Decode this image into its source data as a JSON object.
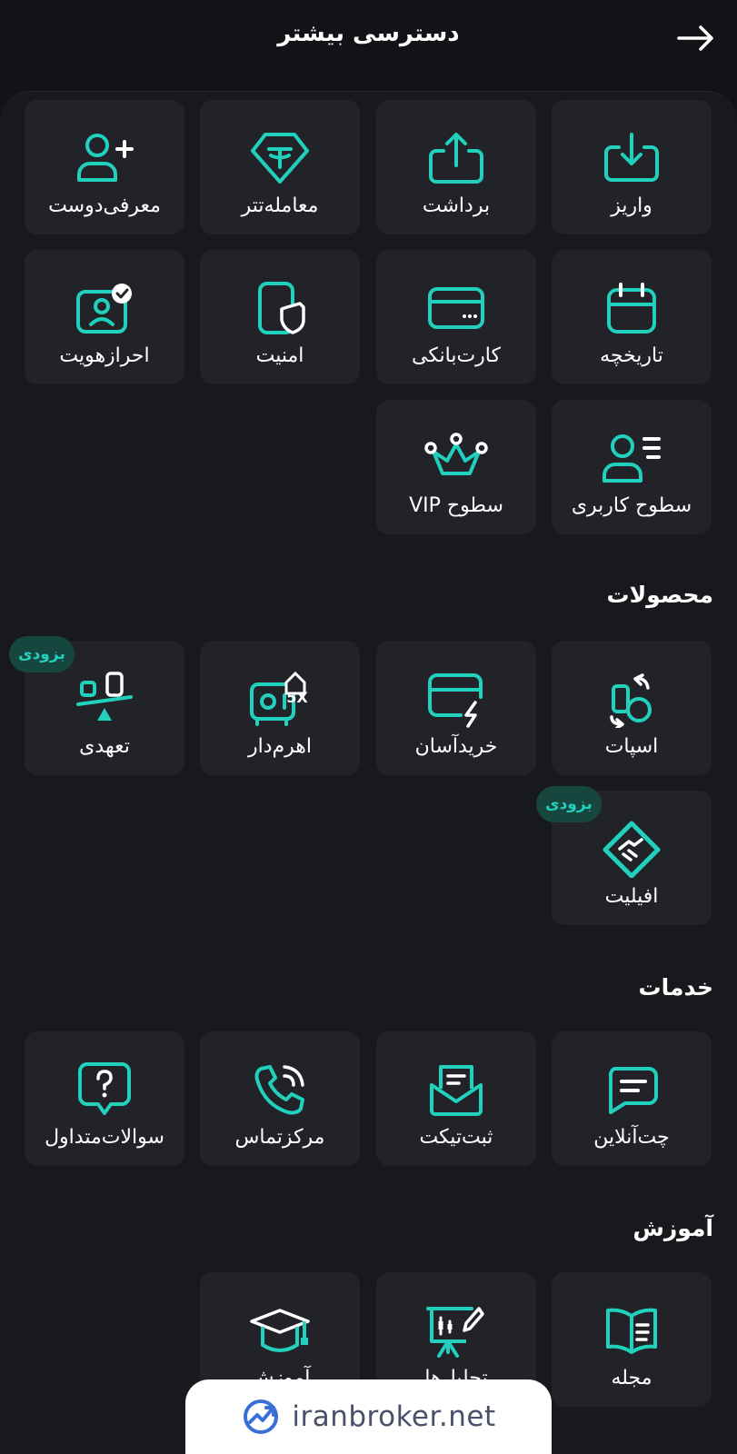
{
  "header": {
    "title": "دسترسی بیشتر"
  },
  "quick_access": [
    {
      "label": "واریز",
      "icon": "deposit-icon"
    },
    {
      "label": "برداشت",
      "icon": "withdraw-icon"
    },
    {
      "label": "معامله‌تتر",
      "icon": "tether-icon"
    },
    {
      "label": "معرفی‌دوست",
      "icon": "invite-friend-icon"
    },
    {
      "label": "تاریخچه",
      "icon": "calendar-icon"
    },
    {
      "label": "کارت‌بانکی",
      "icon": "bank-card-icon"
    },
    {
      "label": "امنیت",
      "icon": "security-icon"
    },
    {
      "label": "احرازهویت",
      "icon": "identity-verify-icon"
    },
    {
      "label": "سطوح کاربری",
      "icon": "user-levels-icon"
    },
    {
      "label": "سطوح VIP",
      "icon": "crown-icon"
    }
  ],
  "products": {
    "title": "محصولات",
    "items": [
      {
        "label": "اسپات",
        "icon": "spot-icon"
      },
      {
        "label": "خریدآسان",
        "icon": "easy-buy-icon"
      },
      {
        "label": "اهرم‌دار",
        "icon": "leverage-icon"
      },
      {
        "label": "تعهدی",
        "icon": "commitment-icon",
        "badge": "بزودی"
      },
      {
        "label": "افیلیت",
        "icon": "affiliate-icon",
        "badge": "بزودی"
      }
    ]
  },
  "services": {
    "title": "خدمات",
    "items": [
      {
        "label": "چت‌آنلاین",
        "icon": "chat-icon"
      },
      {
        "label": "ثبت‌تیکت",
        "icon": "ticket-icon"
      },
      {
        "label": "مرکزتماس",
        "icon": "phone-icon"
      },
      {
        "label": "سوالات‌متداول",
        "icon": "faq-icon"
      }
    ]
  },
  "education": {
    "title": "آموزش",
    "items": [
      {
        "label": "مجله",
        "icon": "magazine-icon"
      },
      {
        "label": "تحلیل‌ها",
        "icon": "analysis-icon"
      },
      {
        "label": "آموزش",
        "icon": "graduation-cap-icon"
      }
    ]
  },
  "watermark": {
    "text": "iranbroker.net"
  },
  "colors": {
    "accent": "#21d0bd",
    "background": "#121316",
    "tile": "#222328",
    "badge_bg": "#17463f"
  }
}
